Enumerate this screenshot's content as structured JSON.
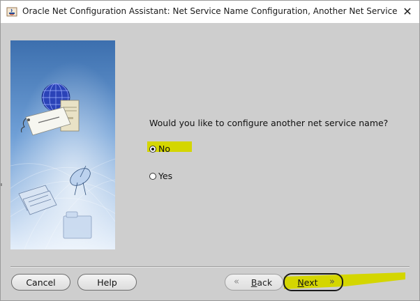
{
  "window": {
    "title": "Oracle Net Configuration Assistant: Net Service Name Configuration, Another Net Service Name?@...",
    "close_glyph": "✕"
  },
  "main": {
    "question": "Would you like to configure another net service name?",
    "options": [
      {
        "label": "No",
        "selected": true
      },
      {
        "label": "Yes",
        "selected": false
      }
    ]
  },
  "buttons": {
    "cancel": "Cancel",
    "help": "Help",
    "back": "Back",
    "back_prefix": "",
    "back_mnemonic": "B",
    "back_rest": "ack",
    "next_mnemonic": "N",
    "next_rest": "ext",
    "back_arrow": "«",
    "next_arrow": "»"
  },
  "colors": {
    "highlight": "#d4d600",
    "panel_top": "#3f74b3",
    "panel_bottom": "#dce9f7"
  }
}
